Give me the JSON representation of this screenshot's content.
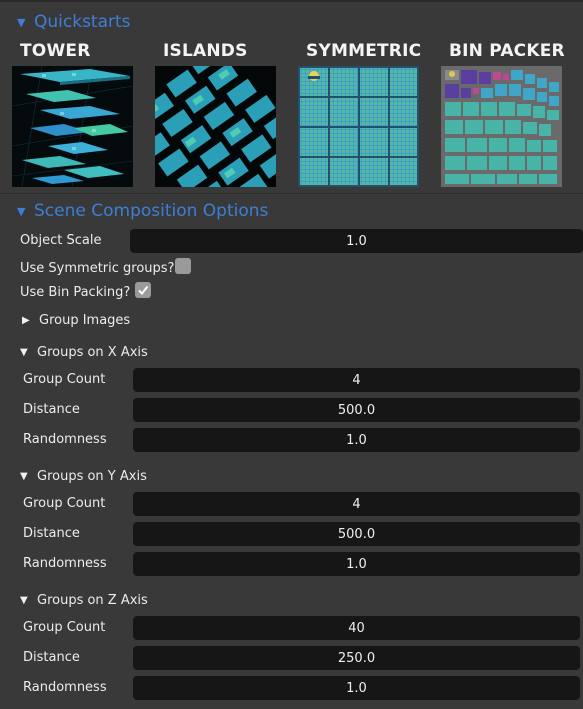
{
  "quickstarts": {
    "title": "Quickstarts",
    "items": [
      {
        "label": "TOWER"
      },
      {
        "label": "ISLANDS"
      },
      {
        "label": "SYMMETRIC"
      },
      {
        "label": "BIN PACKER"
      }
    ]
  },
  "scene": {
    "title": "Scene Composition Options",
    "object_scale": {
      "label": "Object Scale",
      "value": "1.0"
    },
    "use_symmetric": {
      "label": "Use Symmetric groups?",
      "checked": false
    },
    "use_bin_packing": {
      "label": "Use Bin Packing?",
      "checked": true
    },
    "group_images": {
      "label": "Group Images",
      "expanded": false
    },
    "x_axis": {
      "label": "Groups on X Axis",
      "count": {
        "label": "Group Count",
        "value": "4"
      },
      "distance": {
        "label": "Distance",
        "value": "500.0"
      },
      "randomness": {
        "label": "Randomness",
        "value": "1.0"
      }
    },
    "y_axis": {
      "label": "Groups on Y Axis",
      "count": {
        "label": "Group Count",
        "value": "4"
      },
      "distance": {
        "label": "Distance",
        "value": "500.0"
      },
      "randomness": {
        "label": "Randomness",
        "value": "1.0"
      }
    },
    "z_axis": {
      "label": "Groups on Z Axis",
      "count": {
        "label": "Group Count",
        "value": "40"
      },
      "distance": {
        "label": "Distance",
        "value": "250.0"
      },
      "randomness": {
        "label": "Randomness",
        "value": "1.0"
      }
    }
  },
  "colors": {
    "accent": "#3d7fd6",
    "panel": "#393939",
    "field": "#161616"
  },
  "icons": {
    "expanded": "triangle-down-icon",
    "collapsed": "triangle-right-icon",
    "check": "checkmark-icon"
  }
}
